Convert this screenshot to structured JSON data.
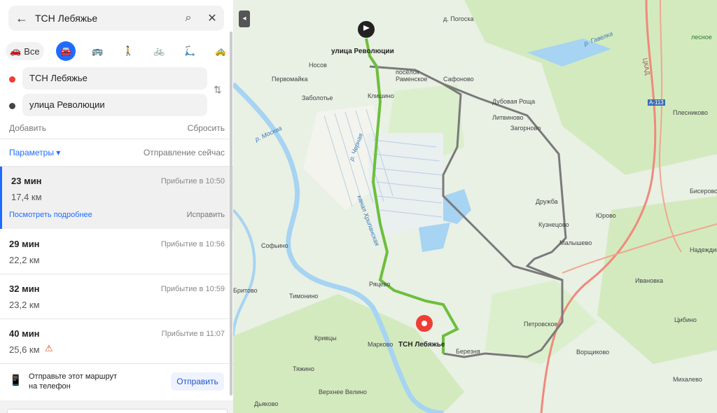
{
  "search": {
    "query": "ТСН Лебяжье"
  },
  "modes": {
    "all_label": "Все",
    "items": [
      "car",
      "bus",
      "walk",
      "bike",
      "scooter",
      "taxi"
    ]
  },
  "points": {
    "from": "ТСН Лебяжье",
    "to": "улица Революции"
  },
  "actions": {
    "add": "Добавить",
    "reset": "Сбросить",
    "params": "Параметры",
    "departure": "Отправление сейчас"
  },
  "routes": [
    {
      "time": "23 мин",
      "dist": "17,4 км",
      "arrival": "Прибытие в 10:50",
      "details": "Посмотреть подробнее",
      "fix": "Исправить"
    },
    {
      "time": "29 мин",
      "dist": "22,2 км",
      "arrival": "Прибытие в 10:56"
    },
    {
      "time": "32 мин",
      "dist": "23,2 км",
      "arrival": "Прибытие в 10:59"
    },
    {
      "time": "40 мин",
      "dist": "25,6 км",
      "arrival": "Прибытие в 11:07"
    }
  ],
  "send": {
    "text1": "Отправьте этот маршрут",
    "text2": "на телефон",
    "button": "Отправить"
  },
  "map": {
    "labels": {
      "start": "улица Революции",
      "end": "ТСН Лебяжье",
      "pogoska": "д. Погоска",
      "nosov": "Носов",
      "pervomaika": "Первомайка",
      "poselok_ramenskoe": "посёлок Раменское",
      "safonovo": "Сафоново",
      "zabolotye": "Заболотье",
      "klishino": "Клишино",
      "dubovaya": "Дубовая Роща",
      "litvino": "Литвиново",
      "zagorno": "Загорново",
      "moskva_river": "р. Москва",
      "chernyaya": "р. Черная",
      "kanal": "канал Хрипанская",
      "druzhba": "Дружба",
      "kuznecovo": "Кузнецово",
      "malyshevo": "Малышево",
      "yurovo": "Юрово",
      "bisеrovo": "Бисерово",
      "nadezhdino": "Надеждино",
      "ivanovka": "Ивановка",
      "sofyino": "Софьино",
      "britovo": "Бритово",
      "timonino": "Тимонино",
      "ryatsevo": "Ряцево",
      "krivtsy": "Кривцы",
      "markovo": "Марково",
      "tyazhino": "Тяжино",
      "verkhnee_velino": "Верхнее Велино",
      "dyakovo": "Дьяково",
      "petrovskoe": "Петровское",
      "vorshchikovo": "Ворщиково",
      "tsybino": "Цибино",
      "mikhalevo": "Михалево",
      "plesnino": "Плесниково",
      "lesnoe": "лесное",
      "a113": "А-113",
      "tskad": "ЦКАД",
      "gavelka": "р. Гавелка",
      "bereznya": "Березня"
    },
    "colors": {
      "route": "#6cbf3c",
      "alt": "#7a7a7a",
      "pin": "#ef3e36",
      "water": "#a6d4f2",
      "forest": "#cde8b8"
    }
  }
}
